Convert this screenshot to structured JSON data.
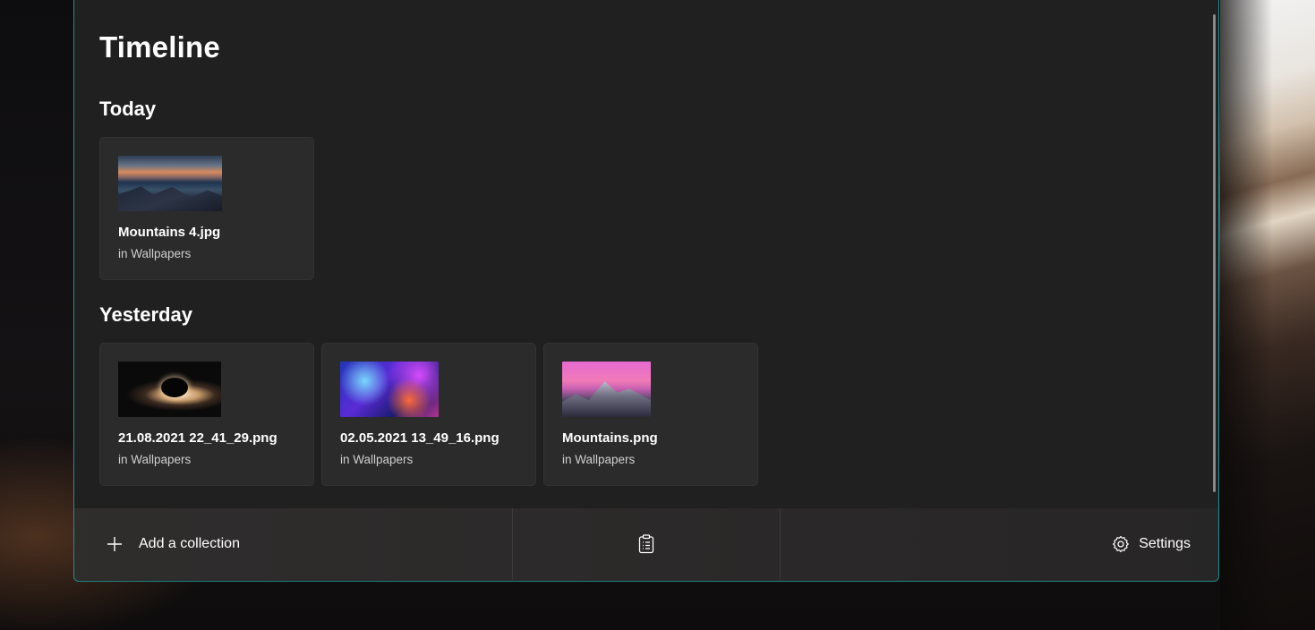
{
  "page": {
    "title": "Timeline"
  },
  "sections": {
    "today": {
      "title": "Today",
      "cards": [
        {
          "name": "Mountains 4.jpg",
          "location": "in Wallpapers"
        }
      ]
    },
    "yesterday": {
      "title": "Yesterday",
      "cards": [
        {
          "name": "21.08.2021 22_41_29.png",
          "location": "in Wallpapers"
        },
        {
          "name": "02.05.2021 13_49_16.png",
          "location": "in Wallpapers"
        },
        {
          "name": "Mountains.png",
          "location": "in Wallpapers"
        }
      ]
    }
  },
  "footer": {
    "add_label": "Add a collection",
    "add_icon": "plus-icon",
    "clipboard_icon": "clipboard-icon",
    "settings_label": "Settings",
    "settings_icon": "gear-icon"
  },
  "colors": {
    "window_bg": "#202020",
    "card_bg": "#2b2b2b",
    "window_border": "#2c8a8c"
  }
}
